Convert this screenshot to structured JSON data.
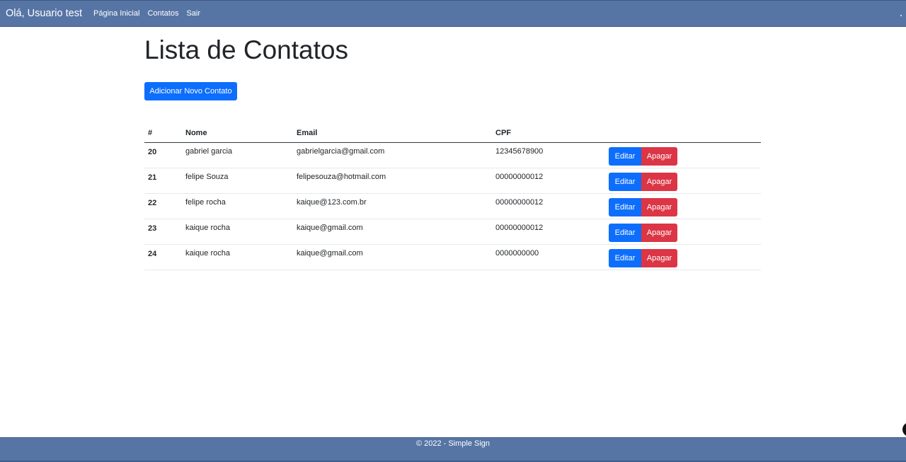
{
  "navbar": {
    "brand": "Olá, Usuario test",
    "links": [
      "Página Inicial",
      "Contatos",
      "Sair"
    ]
  },
  "main": {
    "title": "Lista de Contatos",
    "add_button": "Adicionar Novo Contato"
  },
  "table": {
    "headers": [
      "#",
      "Nome",
      "Email",
      "CPF",
      ""
    ],
    "rows": [
      {
        "id": "20",
        "name": "gabriel garcia",
        "email": "gabrielgarcia@gmail.com",
        "cpf": "12345678900"
      },
      {
        "id": "21",
        "name": "felipe Souza",
        "email": "felipesouza@hotmail.com",
        "cpf": "00000000012"
      },
      {
        "id": "22",
        "name": "felipe rocha",
        "email": "kaique@123.com.br",
        "cpf": "00000000012"
      },
      {
        "id": "23",
        "name": "kaique rocha",
        "email": "kaique@gmail.com",
        "cpf": "00000000012"
      },
      {
        "id": "24",
        "name": "kaique rocha",
        "email": "kaique@gmail.com",
        "cpf": "0000000000"
      }
    ],
    "edit_label": "Editar",
    "delete_label": "Apagar"
  },
  "footer": {
    "text": "© 2022 - Simple Sign"
  },
  "colors": {
    "navbar_bg": "#5675a5",
    "primary": "#0d6efd",
    "danger": "#dc3545"
  }
}
